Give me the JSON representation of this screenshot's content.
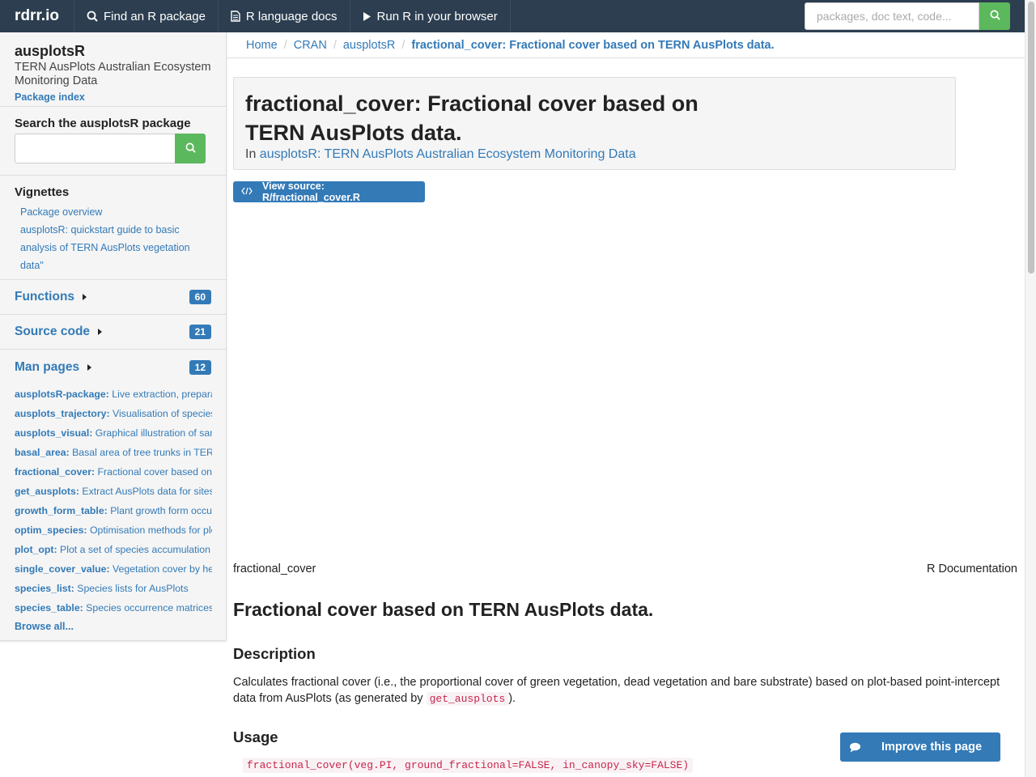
{
  "navbar": {
    "brand": "rdrr.io",
    "items": [
      {
        "label": "Find an R package",
        "icon": "search-icon"
      },
      {
        "label": "R language docs",
        "icon": "document-icon"
      },
      {
        "label": "Run R in your browser",
        "icon": "play-icon"
      }
    ],
    "search_placeholder": "packages, doc text, code..."
  },
  "sidebar": {
    "package_name": "ausplotsR",
    "package_title": "TERN AusPlots Australian Ecosystem Monitoring Data",
    "package_index": "Package index",
    "search_heading": "Search the ausplotsR package",
    "vignettes_heading": "Vignettes",
    "vignettes": [
      "Package overview",
      "ausplotsR: quickstart guide to basic analysis of TERN AusPlots vegetation data\""
    ],
    "functions": {
      "label": "Functions",
      "count": "60"
    },
    "source_code": {
      "label": "Source code",
      "count": "21"
    },
    "man_pages": {
      "label": "Man pages",
      "count": "12"
    },
    "man_items": [
      {
        "name": "ausplotsR-package:",
        "desc": " Live extraction, preparation, visualisation and analysis of"
      },
      {
        "name": "ausplots_trajectory:",
        "desc": " Visualisation of species composition"
      },
      {
        "name": "ausplots_visual:",
        "desc": " Graphical illustration of sampled plots"
      },
      {
        "name": "basal_area:",
        "desc": " Basal area of tree trunks in TERN AusPlots"
      },
      {
        "name": "fractional_cover:",
        "desc": " Fractional cover based on TERN AusPlots data."
      },
      {
        "name": "get_ausplots:",
        "desc": " Extract AusPlots data for sites, species and"
      },
      {
        "name": "growth_form_table:",
        "desc": " Plant growth form occurrence matrices"
      },
      {
        "name": "optim_species:",
        "desc": " Optimisation methods for plot selection"
      },
      {
        "name": "plot_opt:",
        "desc": " Plot a set of species accumulation curves"
      },
      {
        "name": "single_cover_value:",
        "desc": " Vegetation cover by height and growth form"
      },
      {
        "name": "species_list:",
        "desc": " Species lists for AusPlots"
      },
      {
        "name": "species_table:",
        "desc": " Species occurrence matrices"
      }
    ],
    "browse_all": "Browse all..."
  },
  "breadcrumb": {
    "items": [
      "Home",
      "CRAN",
      "ausplotsR"
    ],
    "active": "fractional_cover: Fractional cover based on TERN AusPlots data."
  },
  "main": {
    "title": "fractional_cover: Fractional cover based on TERN AusPlots data.",
    "in_prefix": "In",
    "in_link": "ausplotsR: TERN AusPlots Australian Ecosystem Monitoring Data",
    "view_source": "View source: R/fractional_cover.R",
    "doc_name": "fractional_cover",
    "doc_label": "R Documentation",
    "doc_title": "Fractional cover based on TERN AusPlots data.",
    "description_heading": "Description",
    "description_text": "Calculates fractional cover (i.e., the proportional cover of green vegetation, dead vegetation and bare substrate) based on plot-based point-intercept data from AusPlots (as generated by",
    "description_code": "get_ausplots",
    "description_end": ").",
    "usage_heading": "Usage",
    "usage_code": "fractional_cover(veg.PI, ground_fractional=FALSE, in_canopy_sky=FALSE)"
  },
  "improve_button": "Improve this page",
  "colors": {
    "navbar": "#2c3e50",
    "link": "#337ab7",
    "green": "#5cb85c",
    "code": "#c7254e"
  }
}
